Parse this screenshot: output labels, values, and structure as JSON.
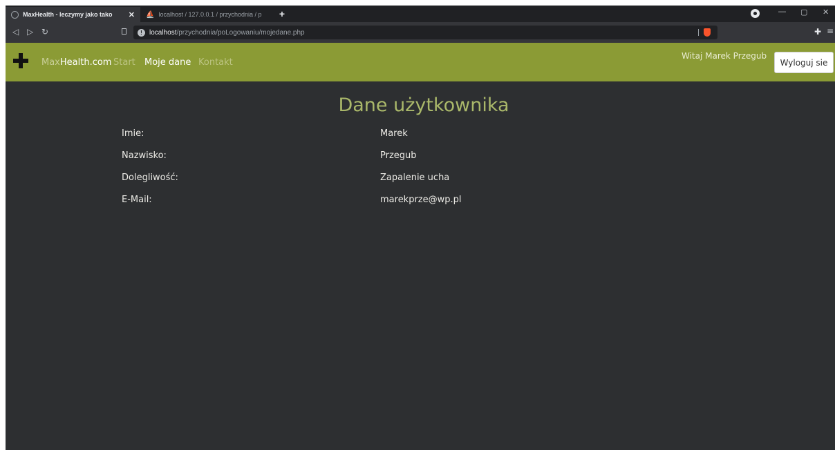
{
  "browser": {
    "tabs": [
      {
        "title": "MaxHealth - leczymy jako tako",
        "active": true
      },
      {
        "title": "localhost / 127.0.0.1 / przychodnia / p",
        "active": false
      }
    ],
    "new_tab": "+",
    "address": {
      "host": "localhost",
      "path": "/przychodnia/poLogowaniu/mojedane.php"
    },
    "window_controls": {
      "minimize": "—",
      "restore": "▢",
      "close": "✕"
    }
  },
  "navbar": {
    "brand_prefix": "Max",
    "brand_suffix": "Health.com",
    "links": {
      "start": "Start",
      "my_data": "Moje dane",
      "contact": "Kontakt"
    },
    "welcome": "Witaj Marek Przegub",
    "logout_label": "Wyloguj sie"
  },
  "page": {
    "title": "Dane użytkownika",
    "fields": [
      {
        "label": "Imie:",
        "value": "Marek"
      },
      {
        "label": "Nazwisko:",
        "value": "Przegub"
      },
      {
        "label": "Dolegliwość:",
        "value": "Zapalenie ucha"
      },
      {
        "label": "E-Mail:",
        "value": "marekprze@wp.pl"
      }
    ]
  },
  "colors": {
    "navbar": "#8b9b35",
    "page_bg": "#2d2f31",
    "title": "#aab86a"
  }
}
